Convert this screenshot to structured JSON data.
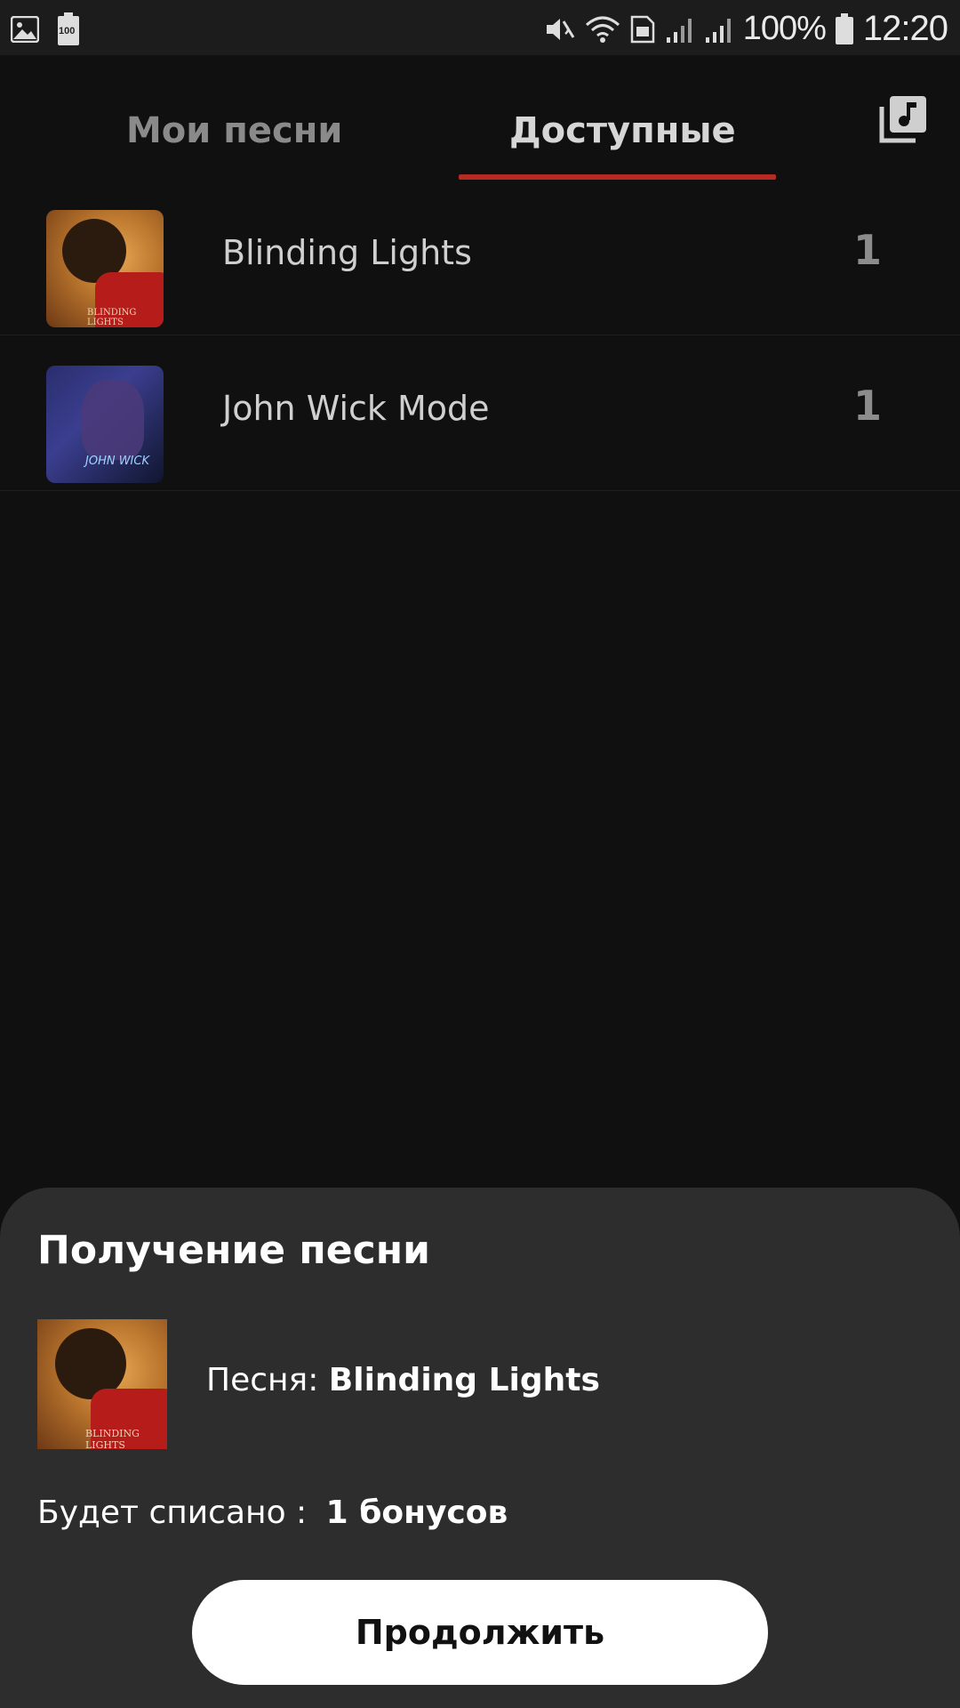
{
  "status_bar": {
    "battery_percent": "100%",
    "time": "12:20",
    "battery_widget_label": "100",
    "icons": [
      "gallery-icon",
      "battery-saver-icon",
      "mute-icon",
      "wifi-icon",
      "sim-hd-icon",
      "signal-icon",
      "signal-icon",
      "battery-icon"
    ]
  },
  "tabs": {
    "mine": "Мои песни",
    "available": "Доступные",
    "active": "available",
    "accent_color": "#b52a22"
  },
  "songs": [
    {
      "title": "Blinding Lights",
      "count": "1",
      "cover_text": "BLINDING LIGHTS"
    },
    {
      "title": "John Wick Mode",
      "count": "1",
      "cover_text": "JOHN WICK"
    }
  ],
  "sheet": {
    "title": "Получение песни",
    "song_label": "Песня:",
    "song_name": "Blinding Lights",
    "cost_label": "Будет списано :",
    "cost_value": "1 бонусов",
    "continue": "Продолжить",
    "cover_text": "BLINDING LIGHTS"
  }
}
